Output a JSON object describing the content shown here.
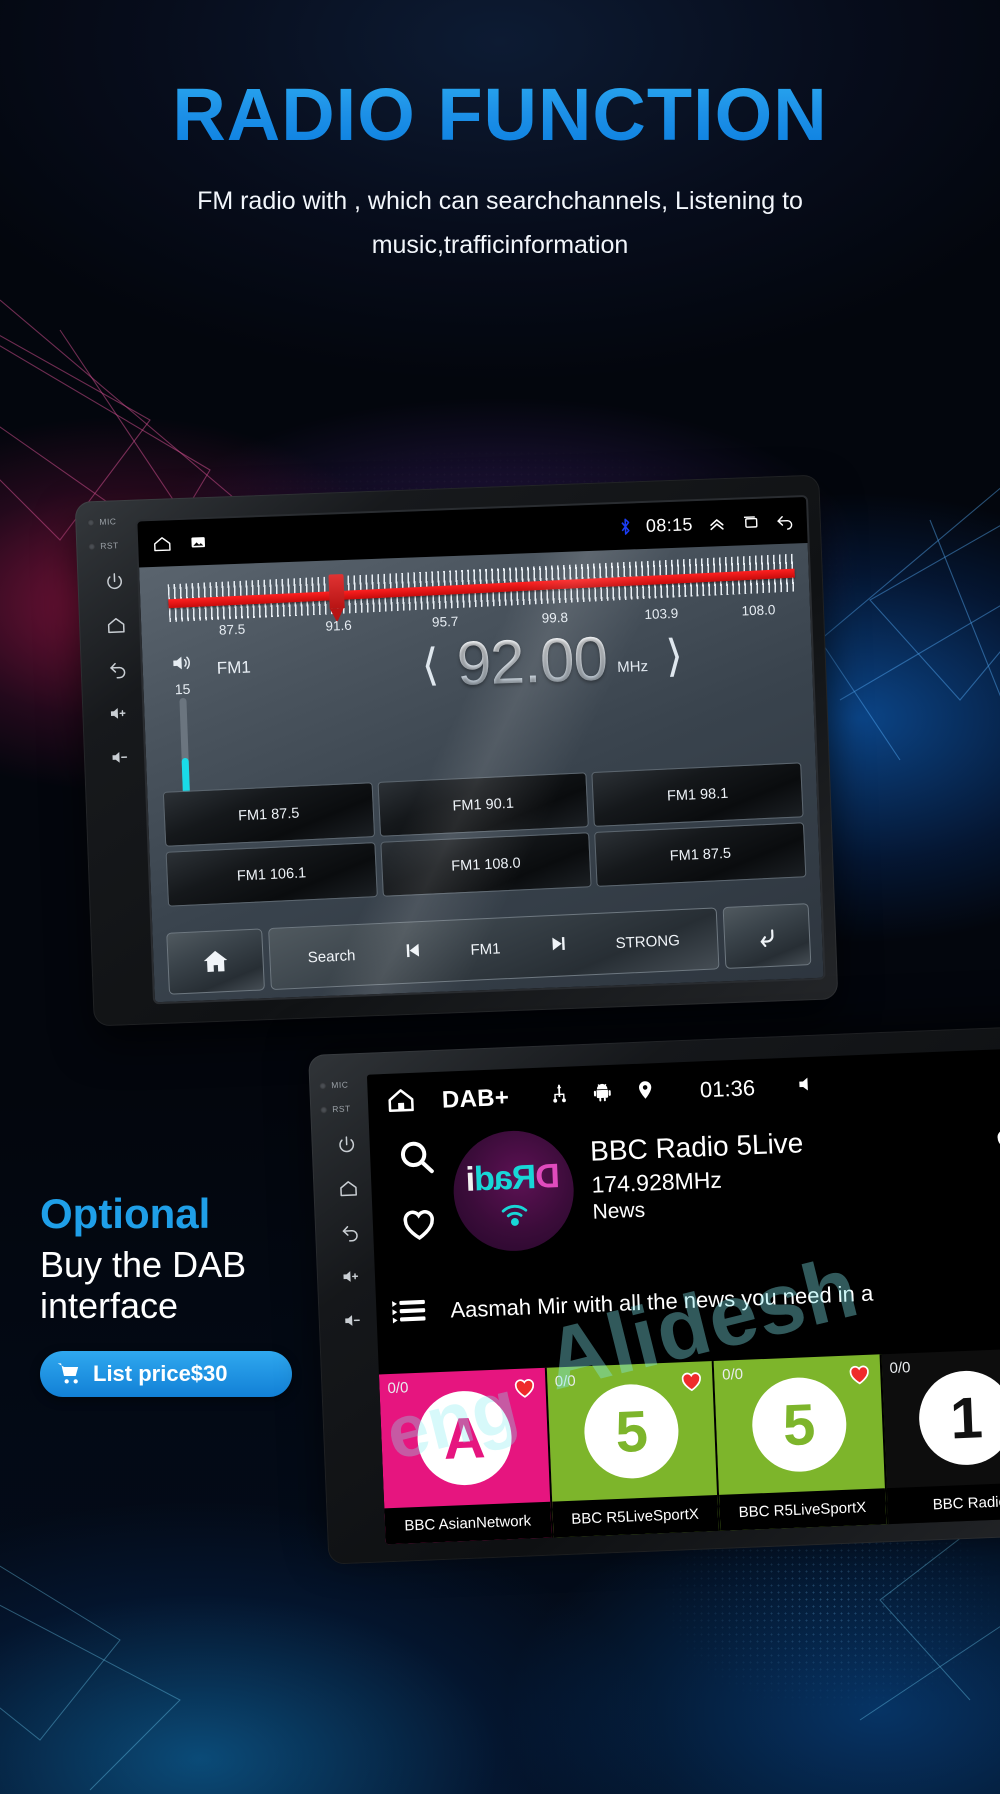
{
  "hero": {
    "title": "RADIO FUNCTION",
    "subtitle": "FM radio with , which can searchchannels, Listening to music,trafficinformation"
  },
  "fm_unit": {
    "side_labels": {
      "mic": "MIC",
      "rst": "RST"
    },
    "status_bar": {
      "home_icon": "home-icon",
      "screenshot_icon": "image-icon",
      "bluetooth_icon": "bluetooth-icon",
      "time": "08:15",
      "expand_icon": "chevron-up-icon",
      "recents_icon": "recents-icon",
      "back_icon": "back-icon"
    },
    "tuner": {
      "labels": [
        "87.5",
        "91.6",
        "95.7",
        "99.8",
        "103.9",
        "108.0"
      ],
      "needle_label": "91.6"
    },
    "volume": {
      "level": "15",
      "icon": "volume-icon"
    },
    "band": "FM1",
    "frequency": "92.00",
    "frequency_unit": "MHz",
    "prev_icon": "chevron-left-icon",
    "next_icon": "chevron-right-icon",
    "presets": [
      "FM1 87.5",
      "FM1 90.1",
      "FM1 98.1",
      "FM1 106.1",
      "FM1 108.0",
      "FM1 87.5"
    ],
    "bottom_bar": {
      "home_icon": "home-icon",
      "search_label": "Search",
      "prev_icon": "previous-track-icon",
      "band_label": "FM1",
      "next_icon": "next-track-icon",
      "strong_label": "STRONG",
      "back_icon": "back-arrow-icon"
    }
  },
  "optional": {
    "tag": "Optional",
    "line1": "Buy the DAB",
    "line2": "interface",
    "price_label": "List price$30",
    "cart_icon": "cart-icon"
  },
  "dab_unit": {
    "side_labels": {
      "mic": "MIC",
      "rst": "RST"
    },
    "top_bar": {
      "home_icon": "home-icon",
      "title": "DAB+",
      "usb_icon": "usb-icon",
      "android_icon": "android-icon",
      "location_icon": "location-pin-icon",
      "time": "01:36",
      "mute_icon": "mute-icon"
    },
    "rail": {
      "search_icon": "search-icon",
      "favorite_icon": "heart-icon",
      "list_icon": "playlist-icon"
    },
    "now_playing": {
      "logo_text": "DRadi",
      "station": "BBC Radio 5Live",
      "frequency": "174.928MHz",
      "genre": "News",
      "favorite_icon": "heart-icon",
      "ticker": "Aasmah Mir with all the news you need in a"
    },
    "tiles": [
      {
        "badge": "0/0",
        "name": "BBC AsianNetwork",
        "glyph": "A",
        "color": "#e6157f",
        "text_color": "#e6157f"
      },
      {
        "badge": "0/0",
        "name": "BBC R5LiveSportX",
        "glyph": "5",
        "color": "#7db52b",
        "text_color": "#7db52b"
      },
      {
        "badge": "0/0",
        "name": "BBC R5LiveSportX",
        "glyph": "5",
        "color": "#7db52b",
        "text_color": "#7db52b"
      },
      {
        "badge": "0/0",
        "name": "BBC Radio",
        "glyph": "1",
        "color": "#111111",
        "text_color": "#111111"
      }
    ]
  },
  "watermark": {
    "text1": "Alidesh",
    "text2": "eng"
  },
  "colors": {
    "accent_blue": "#1f9fe8",
    "tuner_red": "#d41616",
    "volume_cyan": "#19dbe8",
    "bluetooth_blue": "#1b3df5"
  }
}
